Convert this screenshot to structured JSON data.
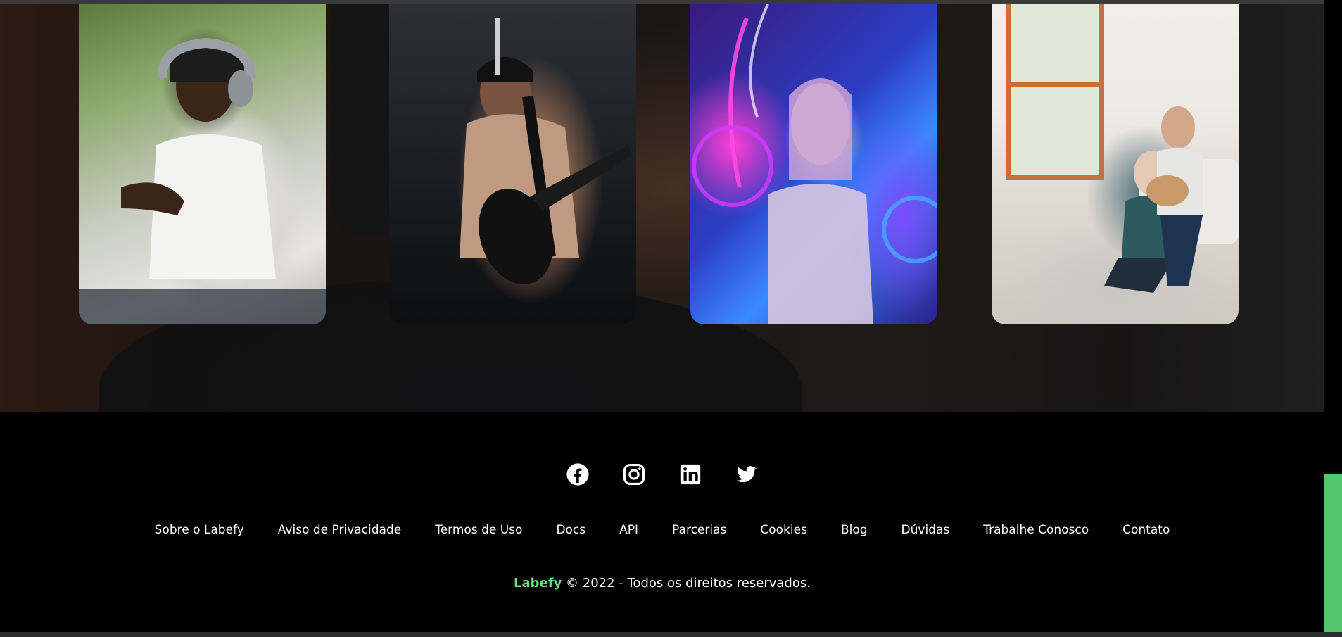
{
  "footer": {
    "social": [
      {
        "icon": "facebook-icon",
        "label": "Facebook"
      },
      {
        "icon": "instagram-icon",
        "label": "Instagram"
      },
      {
        "icon": "linkedin-icon",
        "label": "LinkedIn"
      },
      {
        "icon": "twitter-icon",
        "label": "Twitter"
      }
    ],
    "links": [
      "Sobre o Labefy",
      "Aviso de Privacidade",
      "Termos de Uso",
      "Docs",
      "API",
      "Parcerias",
      "Cookies",
      "Blog",
      "Dúvidas",
      "Trabalhe Conosco",
      "Contato"
    ],
    "brand": "Labefy",
    "copyright": " © 2022 - Todos os direitos reservados."
  },
  "colors": {
    "accent": "#6fe07f",
    "scrollbar_thumb": "#56c46a",
    "footer_bg": "#000000"
  }
}
